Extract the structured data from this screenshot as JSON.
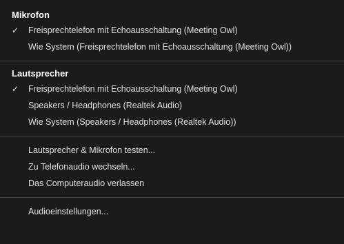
{
  "menu": {
    "sections": {
      "microphone": {
        "title": "Mikrofon",
        "items": [
          {
            "label": "Freisprechtelefon mit Echoausschaltung (Meeting Owl)",
            "checked": true,
            "check_icon": "✓"
          },
          {
            "label": "Wie System (Freisprechtelefon mit Echoausschaltung (Meeting Owl))",
            "checked": false,
            "check_icon": ""
          }
        ]
      },
      "speaker": {
        "title": "Lautsprecher",
        "items": [
          {
            "label": "Freisprechtelefon mit Echoausschaltung (Meeting Owl)",
            "checked": true,
            "check_icon": "✓"
          },
          {
            "label": "Speakers / Headphones (Realtek Audio)",
            "checked": false,
            "check_icon": ""
          },
          {
            "label": "Wie System (Speakers / Headphones (Realtek Audio))",
            "checked": false,
            "check_icon": ""
          }
        ]
      }
    },
    "actions": [
      {
        "label": "Lautsprecher & Mikrofon testen..."
      },
      {
        "label": "Zu Telefonaudio wechseln..."
      },
      {
        "label": "Das Computeraudio verlassen"
      }
    ],
    "settings": {
      "label": "Audioeinstellungen..."
    }
  },
  "colors": {
    "background": "#1b1b1b",
    "text": "#e0e0e0",
    "header": "#ffffff",
    "divider": "#444444"
  }
}
